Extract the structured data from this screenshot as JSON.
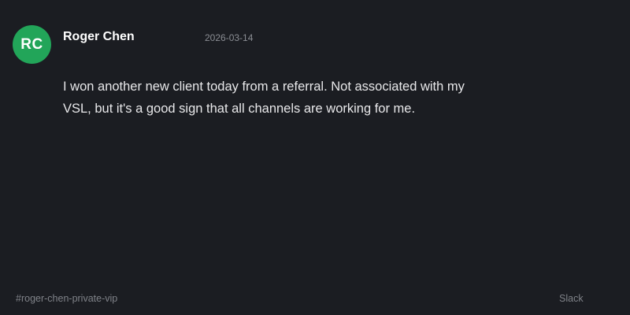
{
  "message": {
    "avatar_initials": "RC",
    "avatar_color": "#22a559",
    "author": "Roger Chen",
    "timestamp": "2026-03-14",
    "text": "I won another new client today from a referral. Not associated with my VSL, but it's a good sign that all channels are working for me."
  },
  "footer": {
    "channel": "#roger-chen-private-vip",
    "source": "Slack"
  }
}
